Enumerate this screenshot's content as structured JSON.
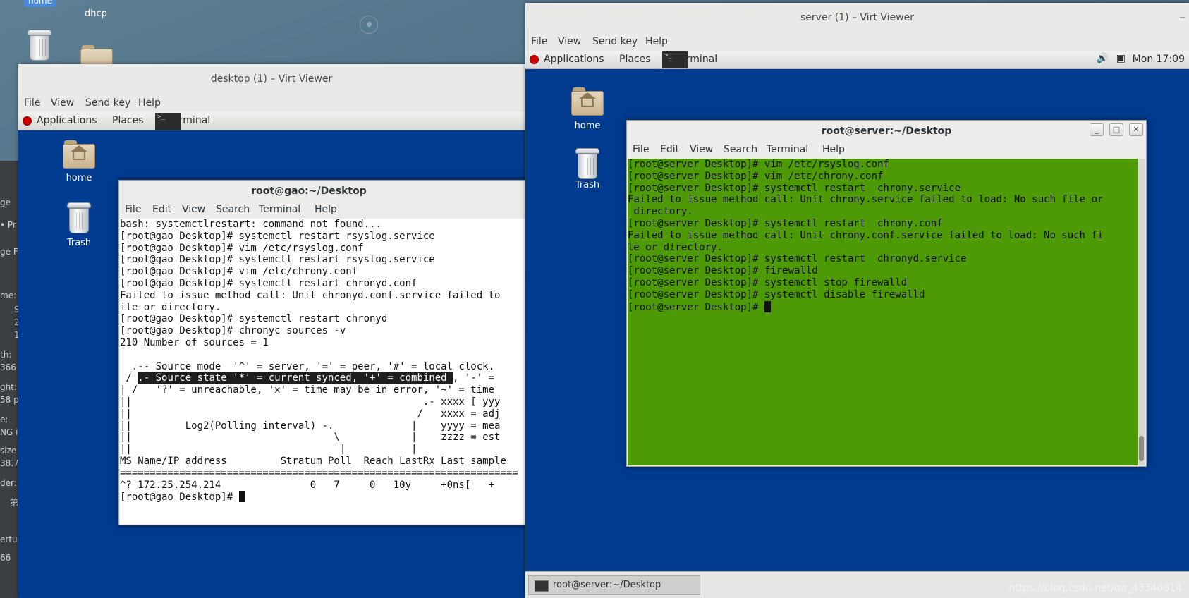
{
  "host": {
    "home_badge": "home",
    "dhcp_label": "dhcp",
    "sidebar_fragments": [
      "ge",
      "• Pr",
      "ge F",
      "me:",
      "S",
      "2",
      "1",
      "th:",
      "366",
      "ght:",
      "58 p",
      "e:",
      "NG i",
      " size",
      "38.7",
      "der:",
      "第",
      "ertur",
      "66"
    ],
    "watermark": "https://blog.csdn.net/qq_43340814"
  },
  "desktop_vv": {
    "title": "desktop (1) – Virt Viewer",
    "menu": [
      "File",
      "View",
      "Send key",
      "Help"
    ],
    "topbar": {
      "applications": "Applications",
      "places": "Places",
      "terminal": "Terminal"
    },
    "icons": [
      {
        "name": "home",
        "label": "home"
      },
      {
        "name": "trash",
        "label": "Trash"
      }
    ],
    "terminal": {
      "title": "root@gao:~/Desktop",
      "menu": [
        "File",
        "Edit",
        "View",
        "Search",
        "Terminal",
        "Help"
      ],
      "lines": [
        "bash: systemctlrestart: command not found...",
        "[root@gao Desktop]# systemctl restart rsyslog.service",
        "[root@gao Desktop]# vim /etc/rsyslog.conf",
        "[root@gao Desktop]# systemctl restart rsyslog.service",
        "[root@gao Desktop]# vim /etc/chrony.conf",
        "[root@gao Desktop]# systemctl restart chronyd.conf",
        "Failed to issue method call: Unit chronyd.conf.service failed to",
        "ile or directory.",
        "[root@gao Desktop]# systemctl restart chronyd",
        "[root@gao Desktop]# chronyc sources -v",
        "210 Number of sources = 1",
        "",
        "  .-- Source mode  '^' = server, '=' = peer, '#' = local clock.",
        "HL",
        "| /   '?' = unreachable, 'x' = time may be in error, '~' = time",
        "||                                                 .- xxxx [ yyy",
        "||                                                /   xxxx = adj",
        "||         Log2(Polling interval) -.             |    yyyy = mea",
        "||                                  \\            |    zzzz = est",
        "||                                   |           |",
        "MS Name/IP address         Stratum Poll  Reach LastRx Last sample",
        "===================================================================",
        "^? 172.25.254.214               0   7     0   10y     +0ns[   +",
        "[root@gao Desktop]# "
      ],
      "highlight_prefix": " / ",
      "highlight_text": ".- Source state '*' = current synced, '+' = combined ",
      "highlight_suffix": ", '-' ="
    }
  },
  "server_vv": {
    "title": "server (1) – Virt Viewer",
    "menu": [
      "File",
      "View",
      "Send key",
      "Help"
    ],
    "topbar": {
      "applications": "Applications",
      "places": "Places",
      "terminal": "Terminal",
      "clock": "Mon 17:09"
    },
    "icons": [
      {
        "name": "home",
        "label": "home"
      },
      {
        "name": "trash",
        "label": "Trash"
      }
    ],
    "terminal": {
      "title": "root@server:~/Desktop",
      "menu": [
        "File",
        "Edit",
        "View",
        "Search",
        "Terminal",
        "Help"
      ],
      "bg_color": "#4e9a06",
      "lines": [
        "[root@server Desktop]# vim /etc/rsyslog.conf",
        "[root@server Desktop]# vim /etc/chrony.conf",
        "[root@server Desktop]# systemctl restart  chrony.service",
        "Failed to issue method call: Unit chrony.service failed to load: No such file or",
        " directory.",
        "[root@server Desktop]# systemctl restart  chrony.conf",
        "Failed to issue method call: Unit chrony.conf.service failed to load: No such fi",
        "le or directory.",
        "[root@server Desktop]# systemctl restart  chronyd.service",
        "[root@server Desktop]# firewalld",
        "[root@server Desktop]# systemctl stop firewalld",
        "[root@server Desktop]# systemctl disable firewalld",
        "[root@server Desktop]# "
      ]
    },
    "taskbar_item": "root@server:~/Desktop"
  }
}
